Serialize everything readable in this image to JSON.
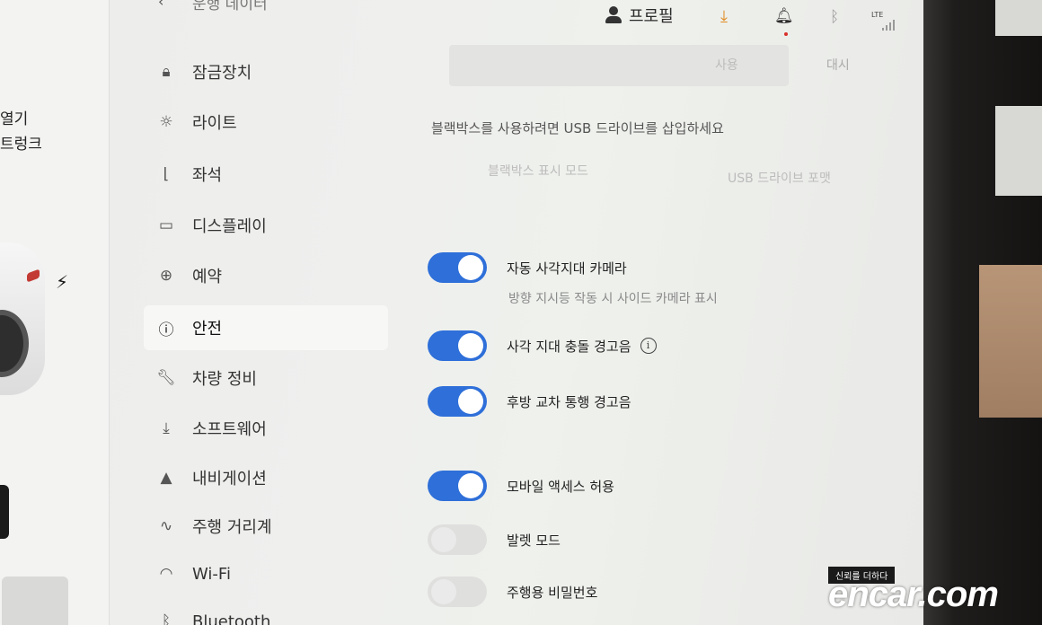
{
  "topbar": {
    "cut_title": "운행 데이터",
    "profile_label": "프로필",
    "network": "LTE",
    "icons": [
      "person-icon",
      "download-icon",
      "bell-icon",
      "bluetooth-icon",
      "signal-icon"
    ]
  },
  "car_panel": {
    "open_label": "열기",
    "trunk_label": "트렁크"
  },
  "sidebar": {
    "items": [
      {
        "label": "잠금장치",
        "icon": "lock-icon"
      },
      {
        "label": "라이트",
        "icon": "light-icon"
      },
      {
        "label": "좌석",
        "icon": "seat-icon"
      },
      {
        "label": "디스플레이",
        "icon": "display-icon"
      },
      {
        "label": "예약",
        "icon": "schedule-icon"
      },
      {
        "label": "안전",
        "icon": "alert-circle-icon",
        "active": true
      },
      {
        "label": "차량 정비",
        "icon": "wrench-icon"
      },
      {
        "label": "소프트웨어",
        "icon": "download-icon"
      },
      {
        "label": "내비게이션",
        "icon": "navigation-icon"
      },
      {
        "label": "주행 거리계",
        "icon": "trip-icon"
      },
      {
        "label": "Wi-Fi",
        "icon": "wifi-icon"
      },
      {
        "label": "Bluetooth",
        "icon": "bluetooth-icon"
      }
    ]
  },
  "main": {
    "ghost_buttons": [
      "사용",
      "대시"
    ],
    "usb_message": "블랙박스를 사용하려면 USB 드라이브를 삽입하세요",
    "dashcam_ghost": "블랙박스 표시 모드",
    "usb_format_ghost": "USB 드라이브 포맷",
    "toggles": [
      {
        "label": "자동 사각지대 카메라",
        "on": true,
        "sublabel": "방향 지시등 작동 시 사이드 카메라 표시"
      },
      {
        "label": "사각 지대 충돌 경고음",
        "on": true,
        "info": "i"
      },
      {
        "label": "후방 교차 통행 경고음",
        "on": true
      },
      {
        "label": "모바일 액세스 허용",
        "on": true
      },
      {
        "label": "발렛 모드",
        "on": false
      },
      {
        "label": "주행용 비밀번호",
        "on": false
      }
    ]
  },
  "watermark": {
    "tag": "신뢰를 더하다",
    "logo": "encar.com"
  },
  "colors": {
    "toggle_on": "#2e6fd9",
    "download_accent": "#e08a1e",
    "notification_dot": "#d9302a"
  }
}
